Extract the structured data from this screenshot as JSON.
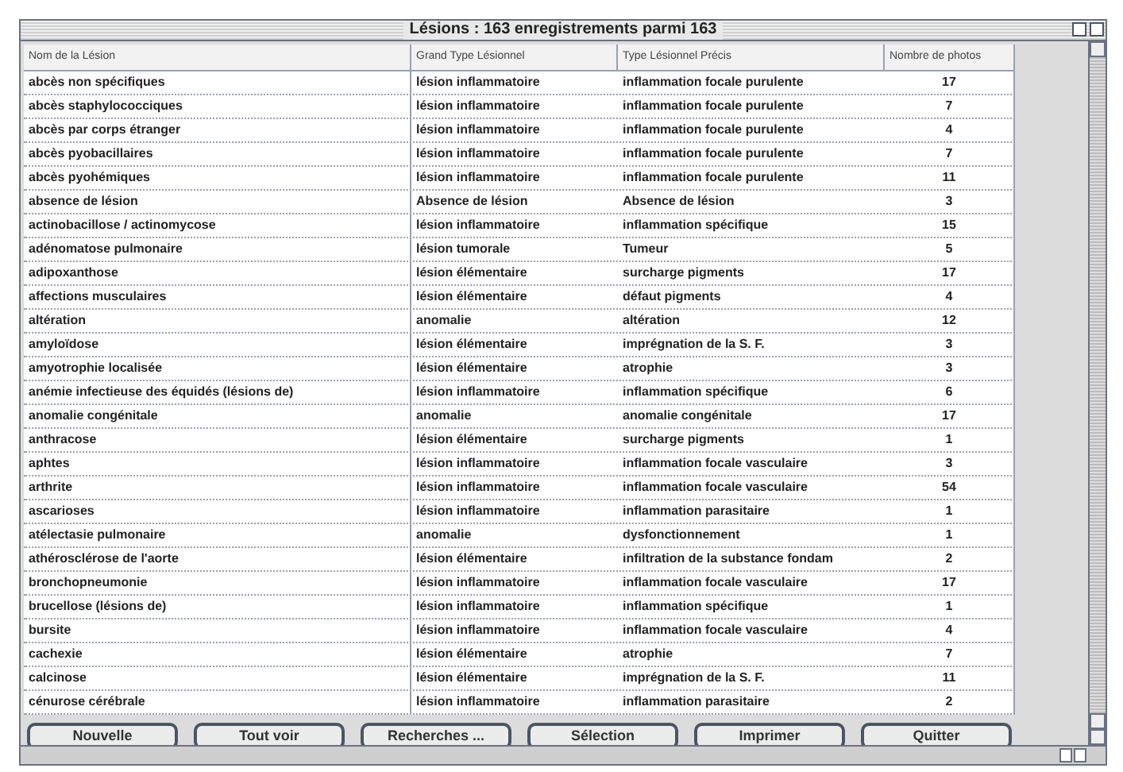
{
  "window": {
    "title": "Lésions : 163 enregistrements parmi 163"
  },
  "table": {
    "columns": [
      "Nom de la Lésion",
      "Grand Type Lésionnel",
      "Type Lésionnel Précis",
      "Nombre de photos"
    ],
    "rows": [
      [
        "abcès non spécifiques",
        "lésion inflammatoire",
        "inflammation focale purulente",
        "17"
      ],
      [
        "abcès staphylococciques",
        "lésion inflammatoire",
        "inflammation focale purulente",
        "7"
      ],
      [
        "abcès par corps étranger",
        "lésion inflammatoire",
        "inflammation focale purulente",
        "4"
      ],
      [
        "abcès pyobacillaires",
        "lésion inflammatoire",
        "inflammation focale purulente",
        "7"
      ],
      [
        "abcès pyohémiques",
        "lésion inflammatoire",
        "inflammation focale purulente",
        "11"
      ],
      [
        "absence de lésion",
        "Absence de lésion",
        "Absence de lésion",
        "3"
      ],
      [
        "actinobacillose / actinomycose",
        "lésion inflammatoire",
        "inflammation spécifique",
        "15"
      ],
      [
        "adénomatose pulmonaire",
        "lésion tumorale",
        "Tumeur",
        "5"
      ],
      [
        "adipoxanthose",
        "lésion élémentaire",
        "surcharge pigments",
        "17"
      ],
      [
        "affections musculaires",
        "lésion élémentaire",
        "défaut pigments",
        "4"
      ],
      [
        "altération",
        "anomalie",
        "altération",
        "12"
      ],
      [
        "amyloïdose",
        "lésion élémentaire",
        "imprégnation de la S. F.",
        "3"
      ],
      [
        "amyotrophie localisée",
        "lésion élémentaire",
        "atrophie",
        "3"
      ],
      [
        "anémie infectieuse des équidés (lésions de)",
        "lésion inflammatoire",
        "inflammation spécifique",
        "6"
      ],
      [
        "anomalie congénitale",
        "anomalie",
        "anomalie congénitale",
        "17"
      ],
      [
        "anthracose",
        "lésion élémentaire",
        "surcharge pigments",
        "1"
      ],
      [
        "aphtes",
        "lésion inflammatoire",
        "inflammation focale vasculaire",
        "3"
      ],
      [
        "arthrite",
        "lésion inflammatoire",
        "inflammation focale vasculaire",
        "54"
      ],
      [
        "ascarioses",
        "lésion inflammatoire",
        "inflammation parasitaire",
        "1"
      ],
      [
        "atélectasie pulmonaire",
        "anomalie",
        "dysfonctionnement",
        "1"
      ],
      [
        "athérosclérose de l'aorte",
        "lésion élémentaire",
        "infiltration de la substance fondam",
        "2"
      ],
      [
        "bronchopneumonie",
        "lésion inflammatoire",
        "inflammation focale vasculaire",
        "17"
      ],
      [
        "brucellose (lésions de)",
        "lésion inflammatoire",
        "inflammation spécifique",
        "1"
      ],
      [
        "bursite",
        "lésion inflammatoire",
        "inflammation focale vasculaire",
        "4"
      ],
      [
        "cachexie",
        "lésion élémentaire",
        "atrophie",
        "7"
      ],
      [
        "calcinose",
        "lésion élémentaire",
        "imprégnation de la S. F.",
        "11"
      ],
      [
        "cénurose cérébrale",
        "lésion inflammatoire",
        "inflammation parasitaire",
        "2"
      ]
    ]
  },
  "buttons": [
    "Nouvelle",
    "Tout voir",
    "Recherches ...",
    "Sélection",
    "Imprimer",
    "Quitter"
  ]
}
